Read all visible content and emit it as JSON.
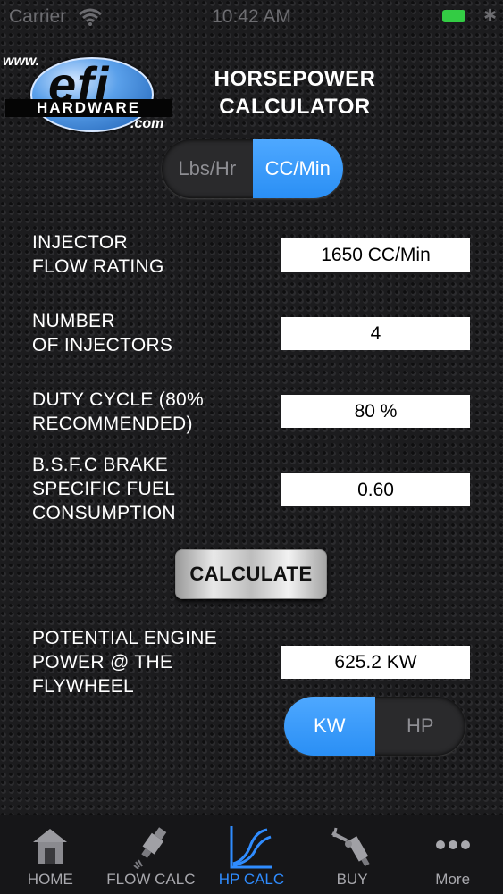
{
  "status_bar": {
    "carrier": "Carrier",
    "time": "10:42 AM"
  },
  "logo": {
    "www": "www.",
    "brand": "efi",
    "hardware": "HARDWARE",
    "com": ".com"
  },
  "header": {
    "title": "HORSEPOWER\nCALCULATOR"
  },
  "unit_toggle": {
    "options": [
      "Lbs/Hr",
      "CC/Min"
    ],
    "selected": "CC/Min"
  },
  "fields": [
    {
      "label": "INJECTOR\nFLOW RATING",
      "value": "1650 CC/Min"
    },
    {
      "label": "NUMBER\nOF INJECTORS",
      "value": "4"
    },
    {
      "label": "DUTY CYCLE (80%\nRECOMMENDED)",
      "value": "80 %"
    },
    {
      "label": "B.S.F.C BRAKE\nSPECIFIC FUEL\nCONSUMPTION",
      "value": "0.60"
    }
  ],
  "calculate_label": "CALCULATE",
  "result": {
    "label": "POTENTIAL ENGINE\nPOWER @ THE\nFLYWHEEL",
    "value": "625.2 KW"
  },
  "power_toggle": {
    "options": [
      "KW",
      "HP"
    ],
    "selected": "KW"
  },
  "tabs": [
    {
      "label": "HOME",
      "icon": "house-icon"
    },
    {
      "label": "FLOW CALC",
      "icon": "injector-icon"
    },
    {
      "label": "HP CALC",
      "icon": "graph-icon",
      "active": true
    },
    {
      "label": "BUY",
      "icon": "parts-icon"
    },
    {
      "label": "More",
      "icon": "more-dots-icon"
    }
  ],
  "colors": {
    "accent": "#2f8cff",
    "segment_active": "#3a9bff",
    "battery": "#33cc44"
  }
}
